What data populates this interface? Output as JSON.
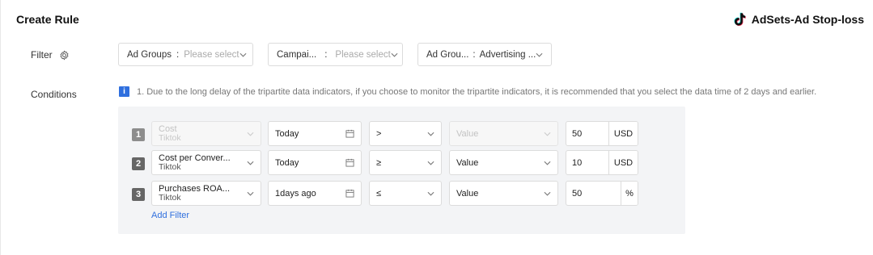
{
  "page": {
    "title": "Create Rule"
  },
  "brand": {
    "name": "AdSets-Ad Stop-loss"
  },
  "filter": {
    "label": "Filter",
    "selects": [
      {
        "key": "Ad Groups",
        "placeholder": "Please select"
      },
      {
        "key": "Campai...",
        "placeholder": "Please select"
      },
      {
        "key": "Ad Grou...",
        "value": "Advertising ..."
      }
    ]
  },
  "conditions": {
    "label": "Conditions",
    "notice": "1. Due to the long delay of the tripartite data indicators, if you choose to monitor the tripartite indicators, it is recommended that you select the data time of 2 days and earlier.",
    "rows": [
      {
        "num": "1",
        "metric": "Cost",
        "source": "Tiktok",
        "date": "Today",
        "op": ">",
        "mode": "Value",
        "value": "50",
        "unit": "USD"
      },
      {
        "num": "2",
        "metric": "Cost per Conver...",
        "source": "Tiktok",
        "date": "Today",
        "op": "≥",
        "mode": "Value",
        "value": "10",
        "unit": "USD"
      },
      {
        "num": "3",
        "metric": "Purchases ROA...",
        "source": "Tiktok",
        "date": "1days ago",
        "op": "≤",
        "mode": "Value",
        "value": "50",
        "unit": "%"
      }
    ],
    "add_filter": "Add Filter"
  }
}
